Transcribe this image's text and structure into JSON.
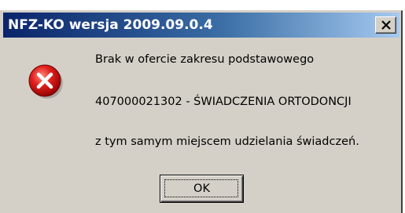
{
  "window": {
    "title": "NFZ-KO wersja 2009.09.0.4",
    "close_icon": "close-x-icon"
  },
  "message": {
    "icon": "error-icon",
    "line1": "Brak w ofercie zakresu podstawowego",
    "line2": "407000021302 - ŚWIADCZENIA ORTODONCJI",
    "line3": "z tym samym miejscem udzielania świadczeń."
  },
  "buttons": {
    "ok_label": "OK"
  },
  "colors": {
    "titlebar_start": "#0a246a",
    "titlebar_end": "#a6caf0",
    "dialog_face": "#d4d0c8",
    "error_red": "#e0201e"
  }
}
